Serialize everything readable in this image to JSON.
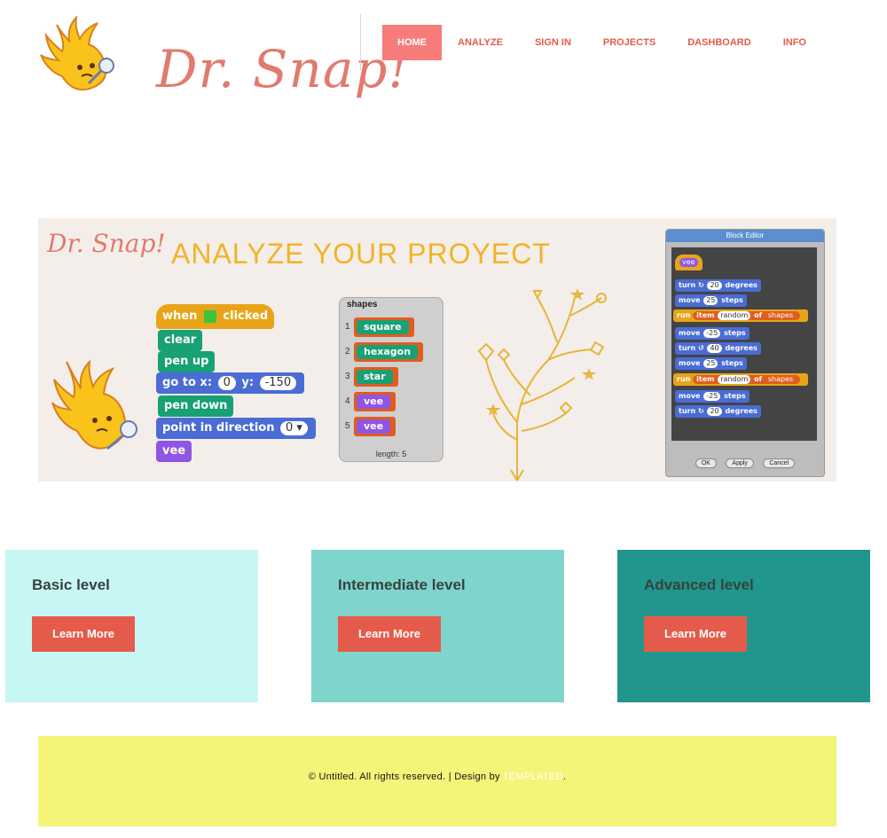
{
  "header": {
    "logo_text": "Dr. Snap!",
    "nav": [
      {
        "label": "HOME",
        "active": true
      },
      {
        "label": "ANALYZE",
        "active": false
      },
      {
        "label": "SIGN IN",
        "active": false
      },
      {
        "label": "PROJECTS",
        "active": false
      },
      {
        "label": "DASHBOARD",
        "active": false
      },
      {
        "label": "INFO",
        "active": false
      }
    ]
  },
  "banner": {
    "logo_text": "Dr. Snap!",
    "title": "ANALYZE YOUR PROYECT",
    "script": {
      "hat": "when",
      "hat_suffix": "clicked",
      "clear": "clear",
      "pen_up": "pen up",
      "goto": "go to x:",
      "goto_x": "0",
      "goto_y_label": "y:",
      "goto_y": "-150",
      "pen_down": "pen down",
      "point": "point in direction",
      "point_value": "0",
      "vee": "vee"
    },
    "shapes_panel": {
      "title": "shapes",
      "items": [
        {
          "index": "1",
          "name": "square"
        },
        {
          "index": "2",
          "name": "hexagon"
        },
        {
          "index": "3",
          "name": "star"
        },
        {
          "index": "4",
          "name": "vee"
        },
        {
          "index": "5",
          "name": "vee"
        }
      ],
      "length_label": "length: 5"
    },
    "block_editor": {
      "title": "Block Editor",
      "hat": "vee",
      "turn_a": "turn",
      "turn_a_value": "20",
      "degrees": "degrees",
      "move": "move",
      "move_a_value": "25",
      "steps": "steps",
      "run": "run",
      "item": "item",
      "random": "random",
      "of": "of",
      "shapes": "shapes",
      "move_b_value": "-25",
      "turn_b_value": "40",
      "move_c_value": "25",
      "move_d_value": "-25",
      "turn_c_value": "20",
      "buttons": [
        "OK",
        "Apply",
        "Cancel"
      ]
    }
  },
  "levels": [
    {
      "title": "Basic level",
      "button": "Learn More",
      "color": "#c7f7f4"
    },
    {
      "title": "Intermediate level",
      "button": "Learn More",
      "color": "#7fd4cc"
    },
    {
      "title": "Advanced level",
      "button": "Learn More",
      "color": "#21968c"
    }
  ],
  "footer": {
    "text": "© Untitled. All rights reserved. | Design by ",
    "link": "TEMPLATED",
    "suffix": "."
  },
  "colors": {
    "accent": "#e55b4b",
    "nav_active": "#f77c79",
    "footer_bg": "#f2f577"
  }
}
